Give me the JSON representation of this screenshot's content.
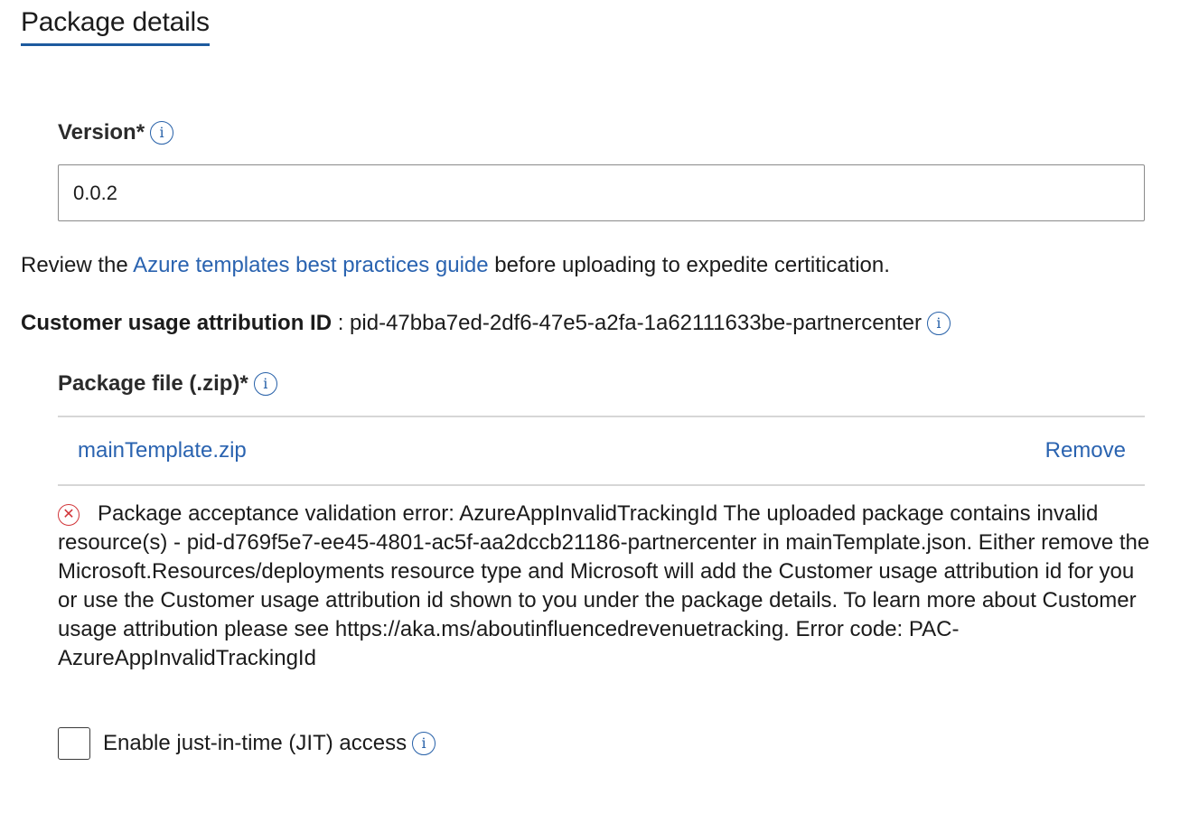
{
  "section": {
    "title": "Package details"
  },
  "version": {
    "label": "Version*",
    "value": "0.0.2",
    "info_icon": "info-icon"
  },
  "review": {
    "prefix": "Review the ",
    "link_text": "Azure templates best practices guide",
    "suffix": " before uploading to expedite certitication."
  },
  "cua": {
    "label": "Customer usage attribution ID",
    "separator": " : ",
    "value": "pid-47bba7ed-2df6-47e5-a2fa-1a62111633be-partnercenter",
    "info_icon": "info-icon"
  },
  "package_file": {
    "label": "Package file (.zip)*",
    "info_icon": "info-icon",
    "file_name": "mainTemplate.zip",
    "remove_label": "Remove"
  },
  "error": {
    "icon": "error-circle-x-icon",
    "message": "Package acceptance validation error: AzureAppInvalidTrackingId The uploaded package contains invalid resource(s) - pid-d769f5e7-ee45-4801-ac5f-aa2dccb21186-partnercenter in mainTemplate.json. Either remove the Microsoft.Resources/deployments resource type and Microsoft will add the Customer usage attribution id for you or use the Customer usage attribution id shown to you under the package details. To learn more about Customer usage attribution please see https://aka.ms/aboutinfluencedrevenuetracking. Error code: PAC-AzureAppInvalidTrackingId"
  },
  "jit": {
    "label": "Enable just-in-time (JIT) access",
    "checked": false,
    "info_icon": "info-icon"
  },
  "colors": {
    "accent": "#1d5a9e",
    "link": "#2a63b0",
    "error": "#d13438",
    "text": "#1b1b1b"
  }
}
